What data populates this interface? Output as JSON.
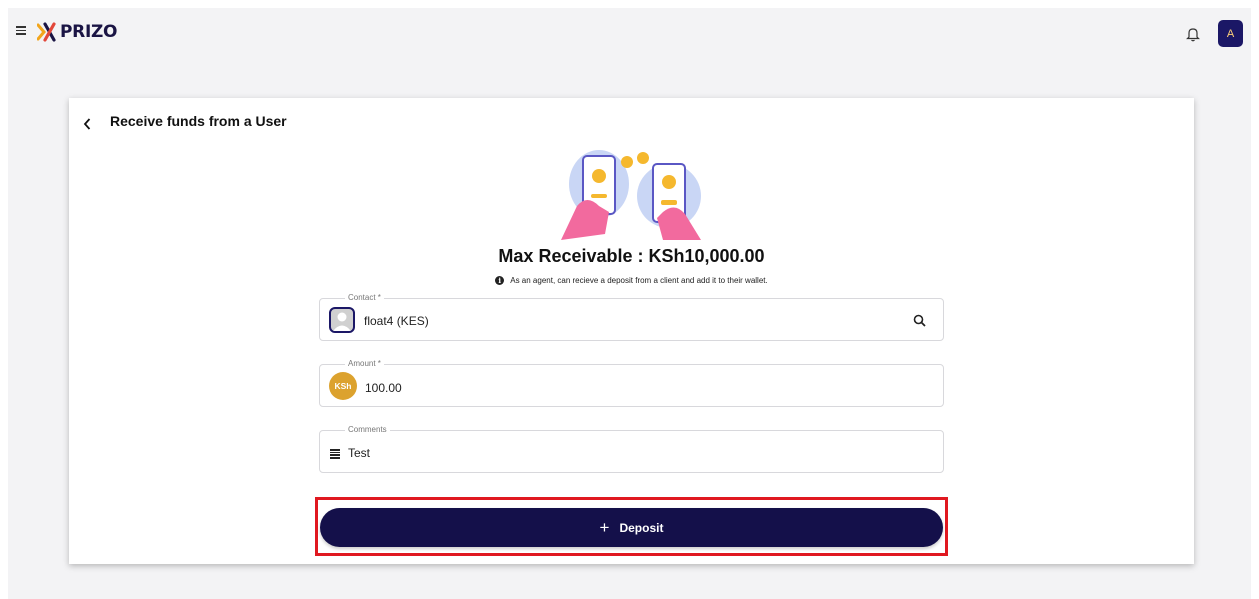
{
  "app": {
    "brand": "PRIZO",
    "user_initial": "A"
  },
  "card": {
    "title": "Receive funds from a User",
    "max_receivable": "Max Receivable : KSh10,000.00",
    "info_text": "As an agent, can recieve a deposit from a client and add it to their wallet."
  },
  "contact": {
    "label": "Contact *",
    "value": "float4 (KES)"
  },
  "amount": {
    "label": "Amount *",
    "currency_badge": "KSh",
    "value": "100.00"
  },
  "comments": {
    "label": "Comments",
    "value": "Test"
  },
  "actions": {
    "deposit_label": "Deposit"
  },
  "colors": {
    "brand_navy": "#14104a",
    "coin_gold": "#dca22e",
    "highlight_red": "#e01820"
  }
}
